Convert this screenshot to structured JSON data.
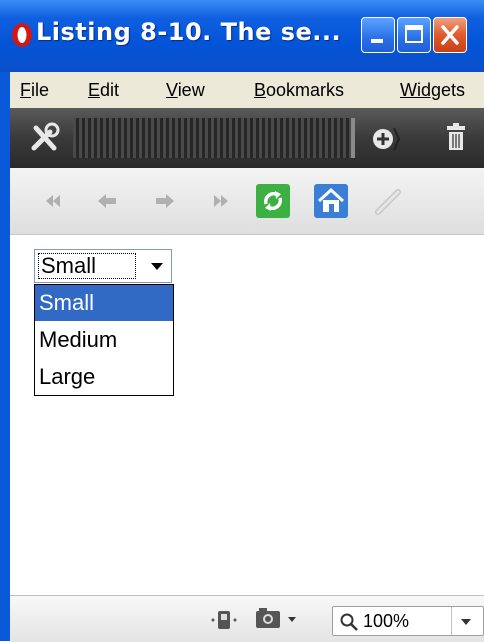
{
  "window": {
    "title": "Listing 8-10. The se..."
  },
  "menu": {
    "items": [
      {
        "first": "F",
        "rest": "ile"
      },
      {
        "first": "E",
        "rest": "dit"
      },
      {
        "first": "V",
        "rest": "iew"
      },
      {
        "first": "B",
        "rest": "ookmarks"
      },
      {
        "first": "Widg",
        "rest": "ets"
      }
    ]
  },
  "toolbar": {
    "icons": [
      "wrench-icon",
      "add-circle-icon",
      "trash-icon"
    ]
  },
  "navigation": {
    "icons": [
      "rewind-icon",
      "back-arrow-icon",
      "forward-arrow-icon",
      "fast-forward-icon",
      "reload-icon",
      "home-icon",
      "edit-pencil-icon"
    ]
  },
  "form": {
    "select": {
      "selected": "Small",
      "options": [
        "Small",
        "Medium",
        "Large"
      ],
      "highlighted_index": 0
    }
  },
  "statusbar": {
    "zoom": "100%"
  },
  "colors": {
    "titlebar": "#0454d8",
    "selection": "#316ac5",
    "menu_bg": "#ece9d8",
    "close_button": "#e05a2a",
    "reload_green": "#3cb043",
    "home_blue": "#3a7fd5"
  }
}
